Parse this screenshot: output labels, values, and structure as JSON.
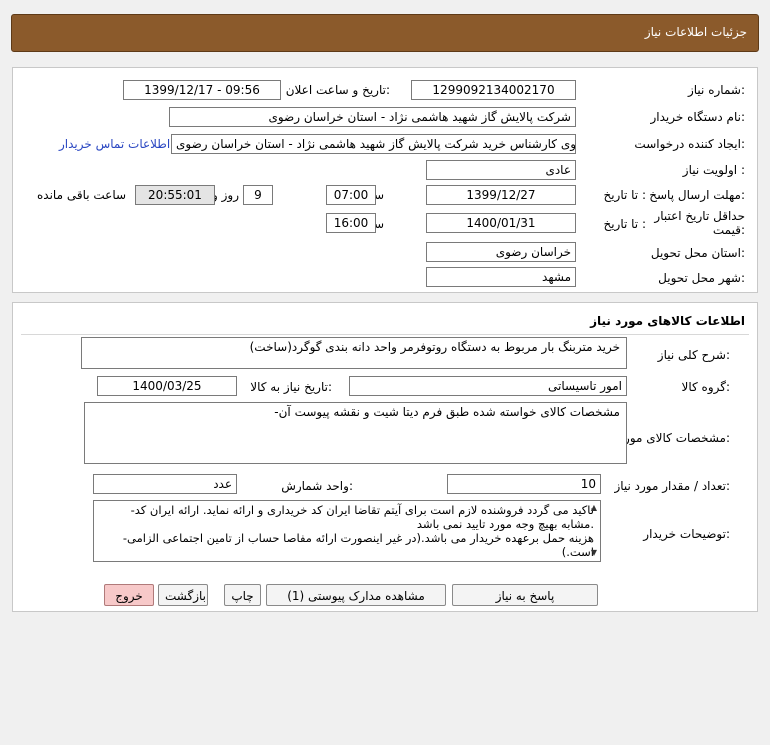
{
  "header": {
    "title": "جزئیات اطلاعات نیاز"
  },
  "details": {
    "need_number_label": "شماره نیاز:",
    "need_number": "1299092134002170",
    "announce_label": "تاریخ و ساعت اعلان عمومی:",
    "announce_value": "1399/12/17 - 09:56",
    "buyer_org_label": "نام دستگاه خریدار:",
    "buyer_org": "شرکت پالایش گاز شهید هاشمی نژاد - استان خراسان رضوی",
    "requester_label": "ایجاد کننده درخواست:",
    "requester": "هاشم مهدوی کارشناس خرید شرکت پالایش گاز شهید هاشمی نژاد - استان خراسان رضوی",
    "contact_link": "اطلاعات تماس خریدار",
    "priority_label": "اولویت نیاز :",
    "priority": "عادی",
    "deadline_label": "مهلت ارسال پاسخ:",
    "until_date_label": "تا تاریخ :",
    "deadline_date": "1399/12/27",
    "time_label": "ساعت",
    "deadline_time": "07:00",
    "days_value": "9",
    "days_label": "روز و",
    "remaining_time": "20:55:01",
    "remaining_label": "ساعت باقی مانده",
    "min_validity_label": "حداقل تاریخ اعتبار قیمت:",
    "validity_until_label": "تا تاریخ :",
    "validity_date": "1400/01/31",
    "validity_time_label": "ساعت",
    "validity_time": "16:00",
    "province_label": "استان محل تحویل:",
    "province": "خراسان رضوی",
    "city_label": "شهر محل تحویل:",
    "city": "مشهد"
  },
  "goods": {
    "section_title": "اطلاعات کالاهای مورد نیاز",
    "general_desc_label": "شرح کلی نیاز:",
    "general_desc": "خرید متربنگ بار مربوط به دستگاه روتوفرمر واحد دانه بندی گوگرد(ساخت)",
    "group_label": "گروه کالا:",
    "group": "امور تاسیساتی",
    "need_date_label": "تاریخ نیاز به کالا:",
    "need_date": "1400/03/25",
    "spec_label": "مشخصات کالای مورد نیاز:",
    "spec": "-مشخصات کالای خواسته شده طبق فرم دیتا شیت و نقشه پیوست آن",
    "qty_label": "تعداد / مقدار مورد نیاز:",
    "qty": "10",
    "unit_label": "واحد شمارش:",
    "unit": "عدد",
    "notes_label": "توضیحات خریدار:",
    "notes_line1": "-تاکید می گردد فروشنده لازم است برای آیتم تقاضا ایران کد خریداری و ارائه نماید. ارائه ایران کد مشابه بهیچ وجه مورد تایید نمی باشد.",
    "notes_line2": "-هزینه حمل برعهده خریدار می باشد.(در غیر اینصورت ارائه مفاصا حساب از تامین اجتماعی الزامی است.)"
  },
  "buttons": {
    "reply": "پاسخ به نیاز",
    "view_docs": "مشاهده مدارک پیوستی (1)",
    "print": "چاپ",
    "back": "بازگشت",
    "exit": "خروج"
  }
}
